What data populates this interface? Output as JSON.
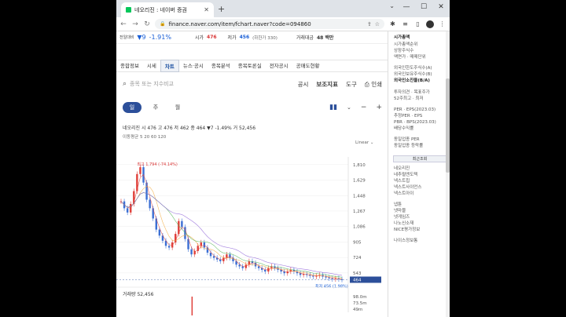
{
  "browser": {
    "tab_title": "네오리진 : 네이버 증권",
    "url": "finance.naver.com/item/fchart.naver?code=094860"
  },
  "summary": {
    "prev_label": "전일대비",
    "change": "▼9",
    "change_pct": "-1.91%",
    "high_label": "시가",
    "high_value": "476",
    "low_label": "저가",
    "low_value": "456",
    "low_extra": "(하한가 330)",
    "vol_label": "거래대금",
    "vol_value": "48 백만"
  },
  "tabs": [
    "종합정보",
    "시세",
    "차트",
    "뉴스·공시",
    "종목분석",
    "종목토론실",
    "전자공시",
    "공매도현황"
  ],
  "active_tab": "차트",
  "search": {
    "placeholder": "종목 또는 지수비교",
    "links": [
      "공시",
      "보조지표",
      "도구",
      "인쇄"
    ]
  },
  "periods": [
    "일",
    "주",
    "월"
  ],
  "active_period": "일",
  "info_line": "네오리진  시 476  고 476  저 462  종 464 ▼7 -1.49%  거 52,456",
  "ma_line": "이동평균  5  20  60  120",
  "scale_label": "Linear",
  "volume_line": "거래량 52,456",
  "chart_data": {
    "type": "line",
    "title": "",
    "ylim": [
      450,
      1900
    ],
    "y_ticks": [
      1810,
      1629,
      1448,
      1267,
      1086,
      905,
      724,
      543
    ],
    "last_price": 464,
    "max_label": "최고 1,794 (-74.14%)",
    "min_label": "최저 456 (1.98%)",
    "series": [
      {
        "values": [
          1380,
          1300,
          1250,
          1350,
          1500,
          1700,
          1780,
          1600,
          1400,
          1300,
          1180,
          1050,
          980,
          920,
          860,
          840,
          900,
          1000,
          1150,
          1080,
          940,
          820,
          760,
          800,
          860,
          900,
          840,
          780,
          740,
          720,
          700,
          680,
          720,
          760,
          720,
          680,
          640,
          620,
          600,
          640,
          680,
          660,
          620,
          600,
          580,
          560,
          600,
          620,
          600,
          580,
          560,
          540,
          560,
          580,
          560,
          540,
          520,
          530,
          520,
          510,
          500,
          510,
          520,
          500,
          490,
          480,
          470,
          480,
          470,
          464
        ]
      }
    ],
    "volume": {
      "label": "거래량",
      "ticks": [
        "98.0m",
        "73.5m",
        "49m"
      ]
    }
  },
  "sidebar": {
    "sec1": [
      "시가총액",
      "시가총액순위",
      "상장주식수",
      "액면가 · 매매단위"
    ],
    "sec2": [
      "외국인한도주식수(A)",
      "외국인보유주식수(B)",
      "외국인소진율(B/A)"
    ],
    "sec3": [
      "투자의견 · 목표주가",
      "52주최고 · 최저"
    ],
    "sec4": [
      "PER · EPS(2023.03)",
      "추정PER · EPS",
      "PBR · BPS(2023.03)",
      "배당수익률"
    ],
    "sec5": [
      "동일업종 PER",
      "동일업종 등락률"
    ],
    "recent_button": "최근조회",
    "recent": [
      "네오리진",
      "네추럴엔도텍",
      "넥스트칩",
      "넥스트사이언스",
      "넥스트아이"
    ],
    "recent2": [
      "넵튠",
      "넷마블",
      "넷게임즈",
      "나노신소재",
      "NICE평가정보"
    ],
    "recent3": [
      "나이스정보통"
    ]
  }
}
